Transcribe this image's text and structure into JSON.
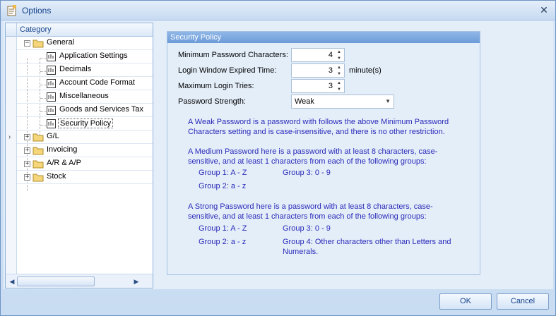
{
  "window": {
    "title": "Options"
  },
  "tree": {
    "header": "Category",
    "nodes": [
      {
        "label": "General",
        "expander": "−"
      },
      {
        "label": "Application Settings"
      },
      {
        "label": "Decimals"
      },
      {
        "label": "Account Code Format"
      },
      {
        "label": "Miscellaneous"
      },
      {
        "label": "Goods and Services Tax"
      },
      {
        "label": "Security Policy"
      },
      {
        "label": "G/L",
        "expander": "+"
      },
      {
        "label": "Invoicing",
        "expander": "+"
      },
      {
        "label": "A/R & A/P",
        "expander": "+"
      },
      {
        "label": "Stock",
        "expander": "+"
      }
    ],
    "selected_marker": "›"
  },
  "security_policy": {
    "group_title": "Security Policy",
    "min_password_label": "Minimum Password Characters:",
    "min_password_value": "4",
    "login_window_label": "Login Window Expired Time:",
    "login_window_value": "3",
    "login_window_unit": "minute(s)",
    "max_login_label": "Maximum Login Tries:",
    "max_login_value": "3",
    "strength_label": "Password Strength:",
    "strength_value": "Weak",
    "weak_line1": "A Weak Password is a password with follows the above Minimum Password",
    "weak_line2": "Characters setting and is case-insensitive, and there is no other restriction.",
    "medium_line1": "A Medium Password here is a password with at least 8 characters, case-",
    "medium_line2": "sensitive, and at least 1 characters from each of the following groups:",
    "medium_group1": "Group 1: A - Z",
    "medium_group3": "Group 3: 0 - 9",
    "medium_group2": "Group 2: a - z",
    "strong_line1": "A Strong Password here is a password with at least 8 characters, case-",
    "strong_line2": "sensitive, and at least 1 characters from each of the following groups:",
    "strong_group1": "Group 1: A - Z",
    "strong_group3": "Group 3: 0 - 9",
    "strong_group2": "Group 2: a - z",
    "strong_group4_line1": "Group 4: Other characters other than Letters and",
    "strong_group4_line2": "Numerals."
  },
  "footer": {
    "ok_label": "OK",
    "cancel_label": "Cancel"
  },
  "colors": {
    "accent": "#15428b",
    "note_text": "#2a2ab8",
    "group_header": "#7aa6de"
  }
}
